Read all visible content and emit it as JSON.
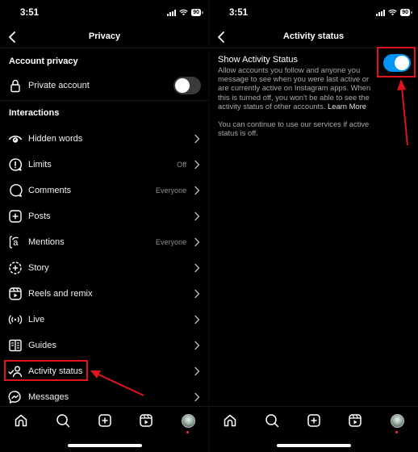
{
  "status_bar": {
    "time": "3:51",
    "battery": "90"
  },
  "left_screen": {
    "title": "Privacy",
    "sections": {
      "account_privacy": {
        "title": "Account privacy",
        "private_account": {
          "label": "Private account",
          "enabled": false
        }
      },
      "interactions": {
        "title": "Interactions",
        "items": [
          {
            "label": "Hidden words",
            "value": "",
            "icon": "eye-icon"
          },
          {
            "label": "Limits",
            "value": "Off",
            "icon": "limits-icon"
          },
          {
            "label": "Comments",
            "value": "Everyone",
            "icon": "comment-icon"
          },
          {
            "label": "Posts",
            "value": "",
            "icon": "add-post-icon"
          },
          {
            "label": "Mentions",
            "value": "Everyone",
            "icon": "at-icon"
          },
          {
            "label": "Story",
            "value": "",
            "icon": "story-add-icon"
          },
          {
            "label": "Reels and remix",
            "value": "",
            "icon": "reels-icon"
          },
          {
            "label": "Live",
            "value": "",
            "icon": "live-icon"
          },
          {
            "label": "Guides",
            "value": "",
            "icon": "guides-icon"
          },
          {
            "label": "Activity status",
            "value": "",
            "icon": "activity-status-icon",
            "highlighted": true
          },
          {
            "label": "Messages",
            "value": "",
            "icon": "messenger-icon"
          }
        ]
      }
    }
  },
  "right_screen": {
    "title": "Activity status",
    "setting": {
      "title": "Show Activity Status",
      "description": "Allow accounts you follow and anyone you message to see when you were last active or are currently active on Instagram apps. When this is turned off, you won't be able to see the activity status of other accounts.",
      "learn_more": "Learn More",
      "enabled": true
    },
    "note": "You can continue to use our services if active status is off."
  },
  "tab_bar": {
    "items": [
      "home-icon",
      "search-icon",
      "create-icon",
      "reels-icon",
      "profile-avatar"
    ]
  },
  "colors": {
    "background": "#000000",
    "toggle_on": "#0095f6",
    "toggle_off": "#3a3a3c",
    "annotation": "#e0141e",
    "secondary_text": "#8e8e8e"
  }
}
